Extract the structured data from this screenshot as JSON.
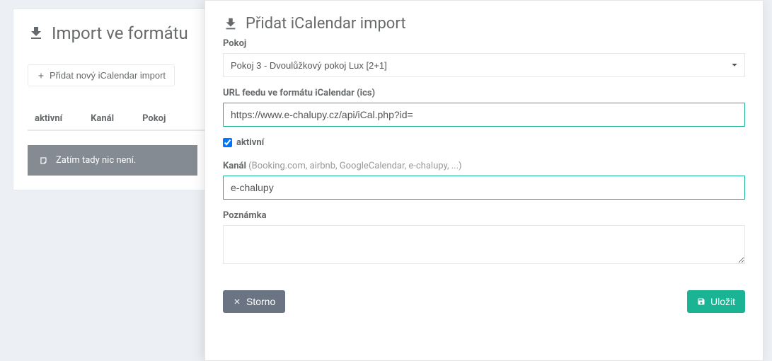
{
  "background": {
    "title": "Import ve formátu",
    "addButton": "Přidat nový iCalendar import",
    "tableHeaders": {
      "active": "aktivní",
      "channel": "Kanál",
      "room": "Pokoj"
    },
    "emptyMessage": "Zatím tady nic není."
  },
  "modal": {
    "title": "Přidat iCalendar import",
    "labels": {
      "room": "Pokoj",
      "url": "URL feedu ve formátu iCalendar (ics)",
      "active": "aktivní",
      "channel": "Kanál",
      "channelHint": "(Booking.com, airbnb, GoogleCalendar, e-chalupy, ...)",
      "note": "Poznámka"
    },
    "values": {
      "room": "Pokoj 3 - Dvoulůžkový pokoj Lux [2+1]",
      "url": "https://www.e-chalupy.cz/api/iCal.php?id=",
      "active": true,
      "channel": "e-chalupy",
      "note": ""
    },
    "buttons": {
      "cancel": "Storno",
      "save": "Uložit"
    }
  }
}
